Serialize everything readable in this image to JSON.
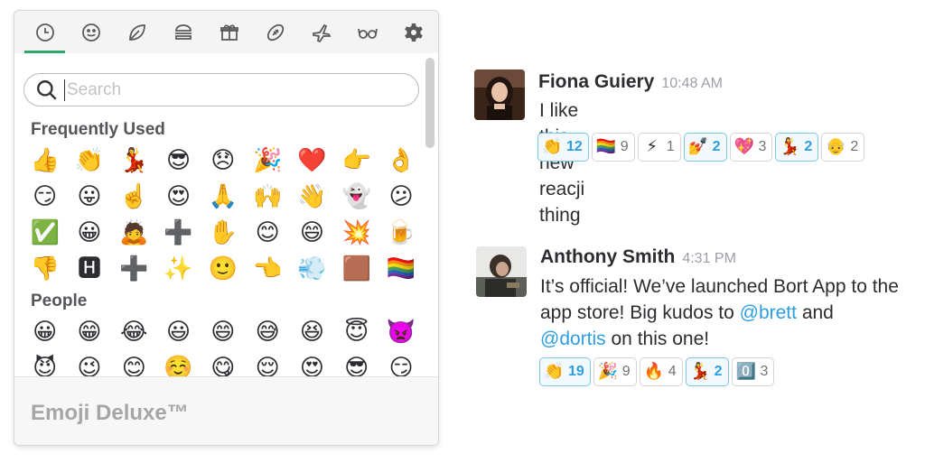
{
  "picker": {
    "tabs": [
      {
        "icon": "clock-icon",
        "active": true
      },
      {
        "icon": "smiley-icon",
        "active": false
      },
      {
        "icon": "leaf-icon",
        "active": false
      },
      {
        "icon": "burger-icon",
        "active": false
      },
      {
        "icon": "gift-icon",
        "active": false
      },
      {
        "icon": "football-icon",
        "active": false
      },
      {
        "icon": "airplane-icon",
        "active": false
      },
      {
        "icon": "glasses-icon",
        "active": false
      },
      {
        "icon": "gear-icon",
        "active": false
      }
    ],
    "search": {
      "placeholder": "Search",
      "value": ""
    },
    "sections": [
      {
        "title": "Frequently Used",
        "emojis": [
          "👍",
          "👏",
          "💃",
          "😎",
          "😞",
          "🎉",
          "❤️",
          "👉",
          "👌",
          "😏",
          "😛",
          "☝️",
          "😍",
          "🙏",
          "🙌",
          "👋",
          "👻",
          "😕",
          "✅",
          "😀",
          "🙇",
          "➕",
          "✋",
          "😊",
          "😄",
          "💥",
          "🍺",
          "👎",
          "🅷",
          "➕",
          "✨",
          "🙂",
          "👈",
          "💨",
          "🟫",
          "🏳️‍🌈"
        ]
      },
      {
        "title": "People",
        "emojis": [
          "😀",
          "😁",
          "😂",
          "😃",
          "😄",
          "😅",
          "😆",
          "😇",
          "👿",
          "😈",
          "😉",
          "😊",
          "☺️",
          "😋",
          "😌",
          "😍",
          "😎",
          "😏"
        ]
      }
    ],
    "footer_title": "Emoji Deluxe™"
  },
  "messages": [
    {
      "author": "Fiona Guiery",
      "time": "10:48 AM",
      "text": "I like this new reacji thing",
      "reactions": [
        {
          "emoji": "👏",
          "count": "12",
          "mine": true
        },
        {
          "emoji": "🏳️‍🌈",
          "count": "9",
          "mine": false
        },
        {
          "emoji": "⚡",
          "count": "1",
          "mine": false
        },
        {
          "emoji": "💅",
          "count": "2",
          "mine": true
        },
        {
          "emoji": "💖",
          "count": "3",
          "mine": false
        },
        {
          "emoji": "💃",
          "count": "2",
          "mine": true
        },
        {
          "emoji": "👴",
          "count": "2",
          "mine": false
        }
      ]
    },
    {
      "author": "Anthony Smith",
      "time": "4:31 PM",
      "text_part1": "It’s official! We’ve launched Bort App to the app store! Big kudos to ",
      "mention1": "@brett",
      "text_part2": " and ",
      "mention2": "@dortis",
      "text_part3": " on this one!",
      "reactions": [
        {
          "emoji": "👏",
          "count": "19",
          "mine": true
        },
        {
          "emoji": "🎉",
          "count": "9",
          "mine": false
        },
        {
          "emoji": "🔥",
          "count": "4",
          "mine": false
        },
        {
          "emoji": "💃",
          "count": "2",
          "mine": true
        },
        {
          "emoji": "0️⃣",
          "count": "3",
          "mine": false
        }
      ]
    }
  ],
  "colors": {
    "accent_green": "#2fa668",
    "mention_blue": "#2d9ee0",
    "reaction_mine_border": "#7fc6e8"
  }
}
